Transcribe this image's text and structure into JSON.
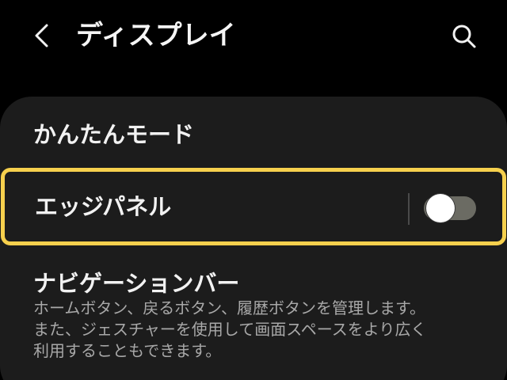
{
  "header": {
    "title": "ディスプレイ",
    "back_icon": "chevron-left-icon",
    "search_icon": "search-icon"
  },
  "settings": {
    "easy_mode": {
      "title": "かんたんモード"
    },
    "edge_panel": {
      "title": "エッジパネル",
      "toggle_on": false,
      "highlight_color": "#f6d04d"
    },
    "navigation_bar": {
      "title": "ナビゲーションバー",
      "description_lines": [
        "ホームボタン、戻るボタン、履歴ボタンを管理します。",
        "また、ジェスチャーを使用して画面スペースをより広く",
        "利用することもできます。"
      ]
    }
  },
  "colors": {
    "background": "#000000",
    "card": "#1c1c1c",
    "toggle_off_track": "#6b6b63",
    "secondary_text": "#a8a8a8"
  }
}
